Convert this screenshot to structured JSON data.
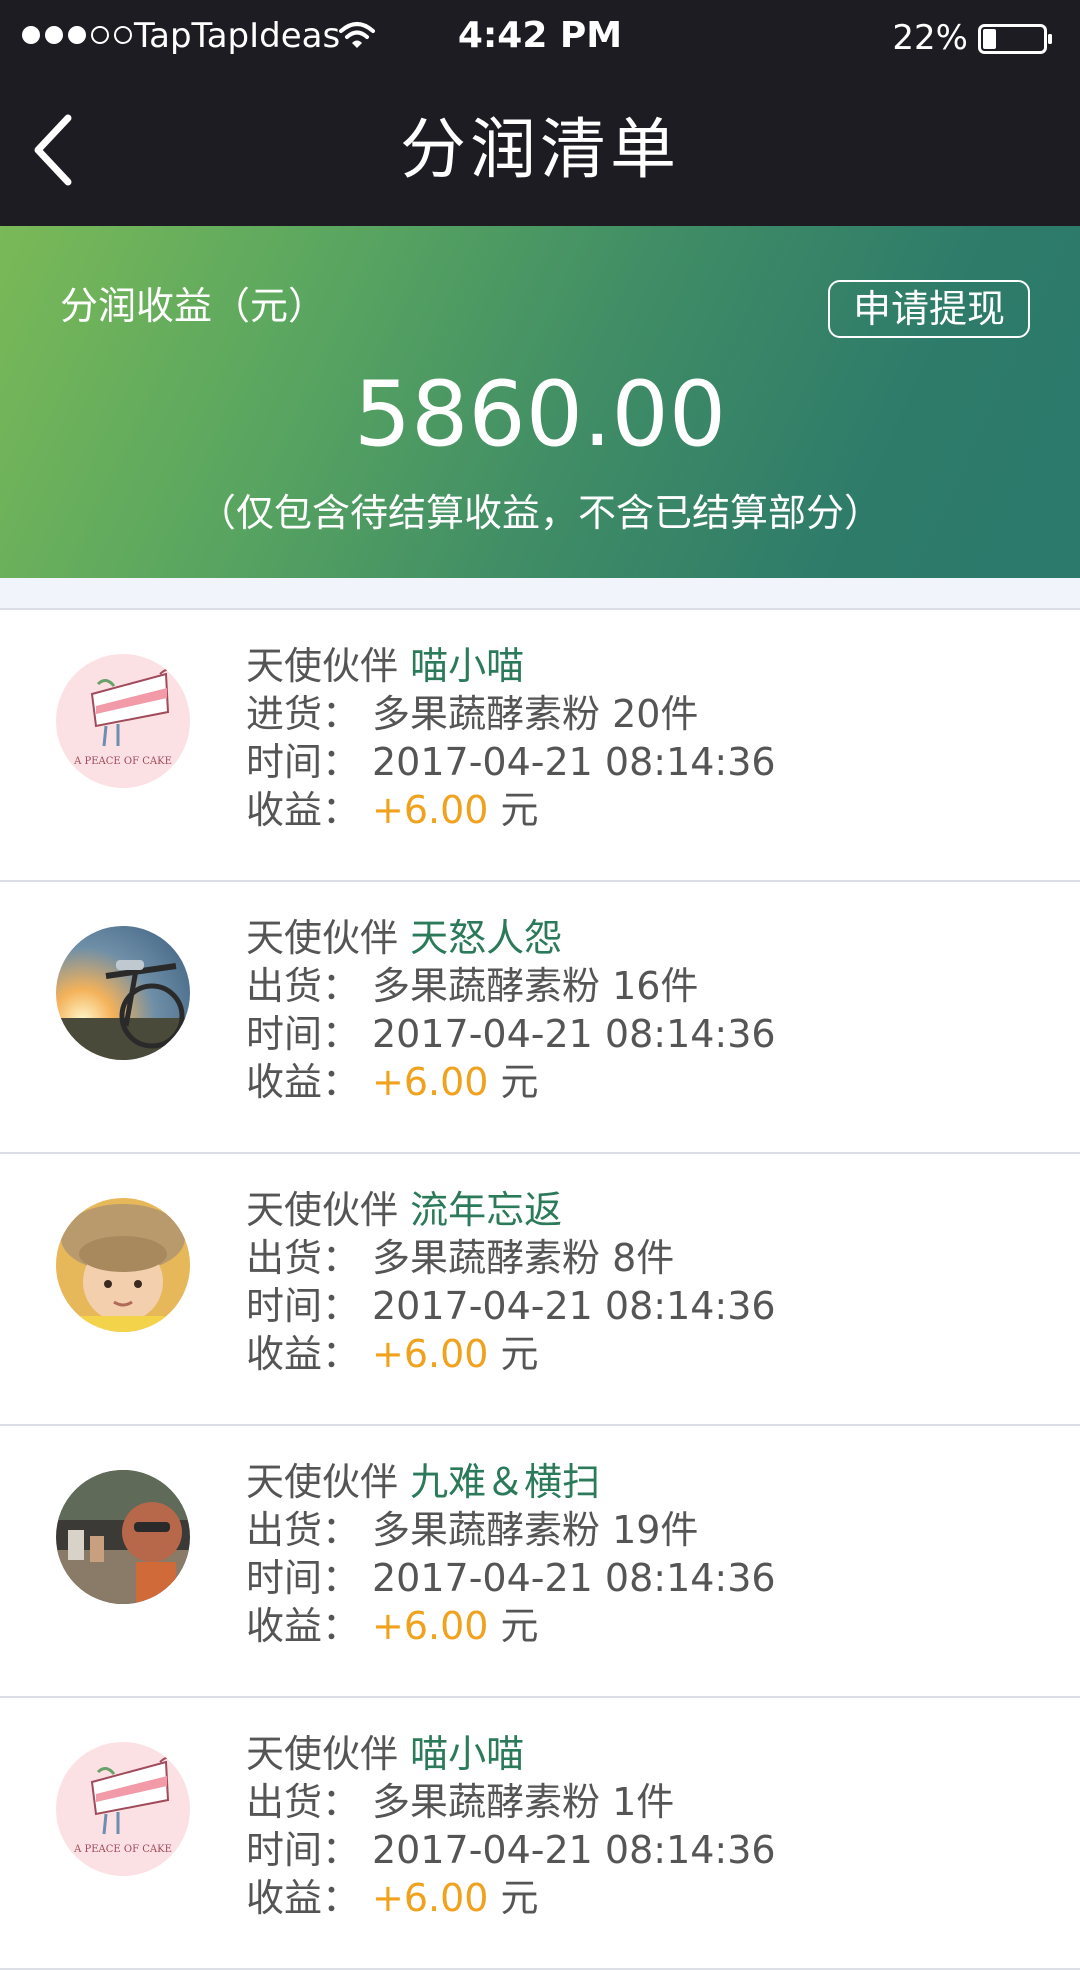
{
  "status_bar": {
    "carrier": "TapTapIdeas",
    "time": "4:42 PM",
    "battery": "22%",
    "battery_level": 0.22
  },
  "nav": {
    "title": "分润清单"
  },
  "banner": {
    "label": "分润收益（元）",
    "withdraw_label": "申请提现",
    "amount": "5860.00",
    "note": "（仅包含待结算收益，不含已结算部分）"
  },
  "colors": {
    "header_bg": "#1d1c22",
    "banner_start": "#7ab957",
    "banner_end": "#2b7a6b",
    "partner_name": "#2b7a5a",
    "income": "#f0a21c"
  },
  "items": [
    {
      "prefix": "天使伙伴",
      "name": "喵小喵",
      "type_label": "进货：",
      "product": "多果蔬酵素粉 20件",
      "time_label": "时间：",
      "time": "2017-04-21 08:14:36",
      "income_label": "收益：",
      "income": "+6.00",
      "unit": "元",
      "avatar_text": "A PEACE OF CAKE",
      "avatar_icon": "cake-avatar-icon"
    },
    {
      "prefix": "天使伙伴",
      "name": "天怒人怨",
      "type_label": "出货：",
      "product": "多果蔬酵素粉 16件",
      "time_label": "时间：",
      "time": "2017-04-21 08:14:36",
      "income_label": "收益：",
      "income": "+6.00",
      "unit": "元",
      "avatar_icon": "bicycle-sunset-avatar-icon"
    },
    {
      "prefix": "天使伙伴",
      "name": "流年忘返",
      "type_label": "出货：",
      "product": "多果蔬酵素粉 8件",
      "time_label": "时间：",
      "time": "2017-04-21 08:14:36",
      "income_label": "收益：",
      "income": "+6.00",
      "unit": "元",
      "avatar_icon": "baby-avatar-icon"
    },
    {
      "prefix": "天使伙伴",
      "name": "九难＆横扫",
      "type_label": "出货：",
      "product": "多果蔬酵素粉 19件",
      "time_label": "时间：",
      "time": "2017-04-21 08:14:36",
      "income_label": "收益：",
      "income": "+6.00",
      "unit": "元",
      "avatar_icon": "street-photo-avatar-icon"
    },
    {
      "prefix": "天使伙伴",
      "name": "喵小喵",
      "type_label": "出货：",
      "product": "多果蔬酵素粉 1件",
      "time_label": "时间：",
      "time": "2017-04-21 08:14:36",
      "income_label": "收益：",
      "income": "+6.00",
      "unit": "元",
      "avatar_text": "A PEACE OF CAKE",
      "avatar_icon": "cake-avatar-icon"
    }
  ]
}
